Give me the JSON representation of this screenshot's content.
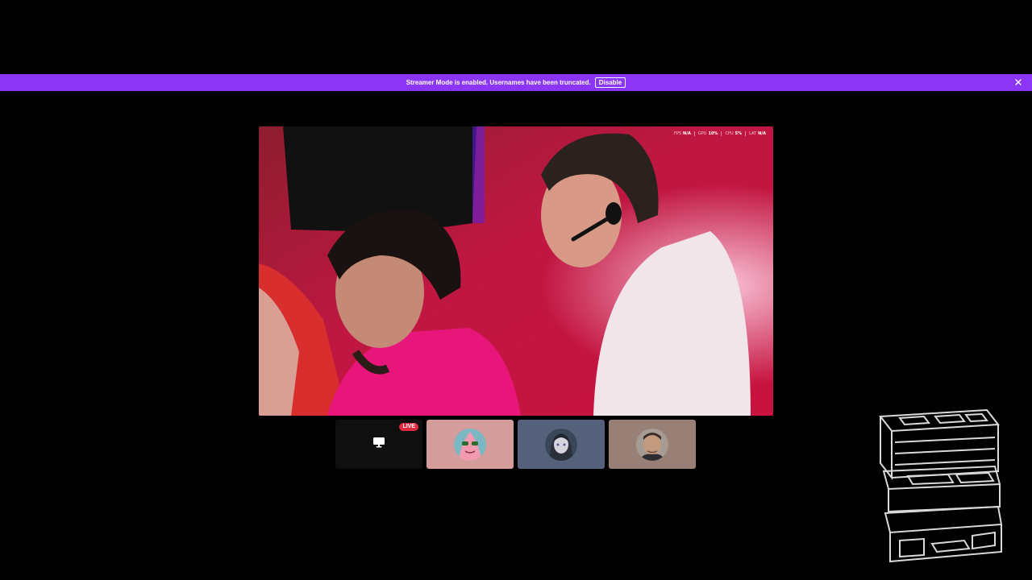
{
  "notice": {
    "message": "Streamer Mode is enabled. Usernames have been truncated.",
    "disable_label": "Disable"
  },
  "stream": {
    "stats": [
      {
        "label": "FPS",
        "value": "N/A"
      },
      {
        "label": "GPU",
        "value": "10%"
      },
      {
        "label": "CPU",
        "value": "5%"
      },
      {
        "label": "LAT",
        "value": "N/A"
      }
    ]
  },
  "tiles": {
    "live_label": "LIVE"
  },
  "colors": {
    "notice_bg": "#8c35f5",
    "live_badge": "#e0283f",
    "page_bg": "#000000"
  },
  "icons": {
    "close": "close-icon",
    "screen_share": "screen-share-icon",
    "logo": "cube-logo"
  }
}
